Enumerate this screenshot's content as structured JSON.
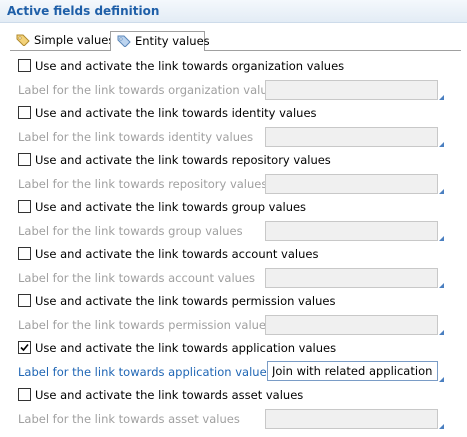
{
  "section": {
    "title": "Active fields definition"
  },
  "tabs": [
    {
      "label": "Simple values",
      "icon": "tag-icon"
    },
    {
      "label": "Entity values",
      "icon": "tag-icon"
    }
  ],
  "rows": [
    {
      "check_label": "Use and activate the link towards organization values",
      "checked": false,
      "field_label": "Label for the link towards organization values",
      "value": ""
    },
    {
      "check_label": "Use and activate the link towards identity values",
      "checked": false,
      "field_label": "Label for the link towards identity values",
      "value": ""
    },
    {
      "check_label": "Use and activate the link towards repository values",
      "checked": false,
      "field_label": "Label for the link towards repository values",
      "value": ""
    },
    {
      "check_label": "Use and activate the link towards group values",
      "checked": false,
      "field_label": "Label for the link towards group values",
      "value": ""
    },
    {
      "check_label": "Use and activate the link towards account values",
      "checked": false,
      "field_label": "Label for the link towards account values",
      "value": ""
    },
    {
      "check_label": "Use and activate the link towards permission values",
      "checked": false,
      "field_label": "Label for the link towards permission values",
      "value": ""
    },
    {
      "check_label": "Use and activate the link towards application values",
      "checked": true,
      "field_label": "Label for the link towards application values",
      "value": "Join with related applications"
    },
    {
      "check_label": "Use and activate the link towards asset values",
      "checked": false,
      "field_label": "Label for the link towards asset values",
      "value": ""
    }
  ],
  "colors": {
    "title": "#1f5fa8",
    "active_label": "#1f66b5",
    "disabled_label": "#a0a0a0"
  }
}
